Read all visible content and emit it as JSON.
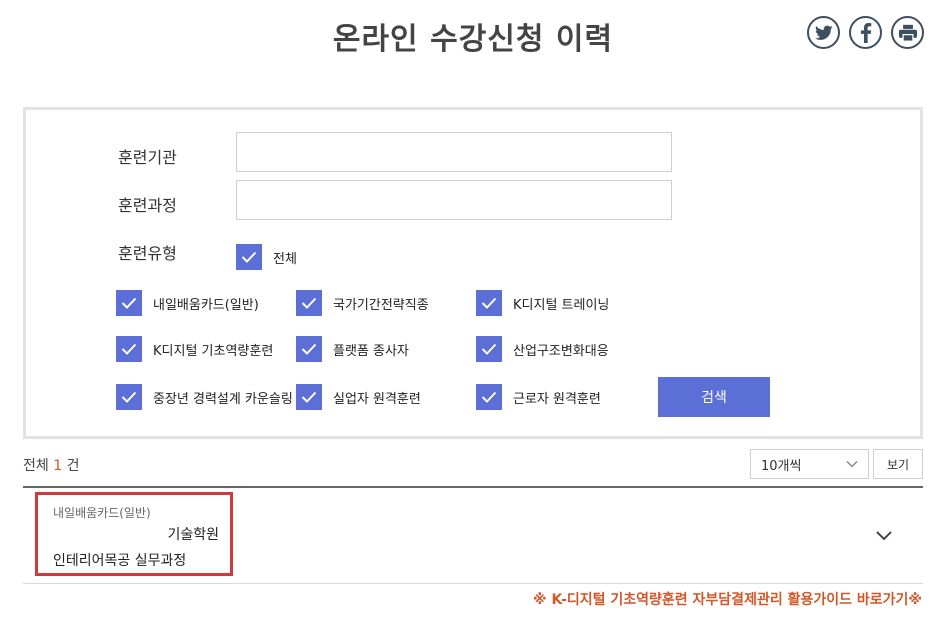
{
  "page": {
    "title": "온라인 수강신청 이력"
  },
  "share": {
    "twitter_icon": "twitter-icon",
    "facebook_icon": "facebook-icon",
    "print_icon": "printer-icon",
    "icon_color": "#3d4f60"
  },
  "search": {
    "institution_label": "훈련기관",
    "institution_value": "",
    "course_label": "훈련과정",
    "course_value": "",
    "type_label": "훈련유형",
    "all_label": "전체",
    "types": [
      {
        "label": "내일배움카드(일반)",
        "checked": true
      },
      {
        "label": "국가기간전략직종",
        "checked": true
      },
      {
        "label": "K디지털 트레이닝",
        "checked": true
      },
      {
        "label": "K디지털 기초역량훈련",
        "checked": true
      },
      {
        "label": "플랫폼 종사자",
        "checked": true
      },
      {
        "label": "산업구조변화대응",
        "checked": true
      },
      {
        "label": "중장년 경력설계 카운슬링",
        "checked": true
      },
      {
        "label": "실업자 원격훈련",
        "checked": true
      },
      {
        "label": "근로자 원격훈련",
        "checked": true
      }
    ],
    "search_button": "검색",
    "accent_color": "#5c6fd7"
  },
  "results": {
    "total_prefix": "전체",
    "total_count": "1",
    "total_suffix": "건",
    "per_page": "10개씩",
    "view_button": "보기",
    "items": [
      {
        "type": "내일배움카드(일반)",
        "institution": "기술학원",
        "course": "인테리어목공 실무과정"
      }
    ]
  },
  "guide": {
    "link_text": "※ K-디지털 기초역량훈련 자부담결제관리 활용가이드 바로가기※",
    "color": "#d2582a"
  }
}
